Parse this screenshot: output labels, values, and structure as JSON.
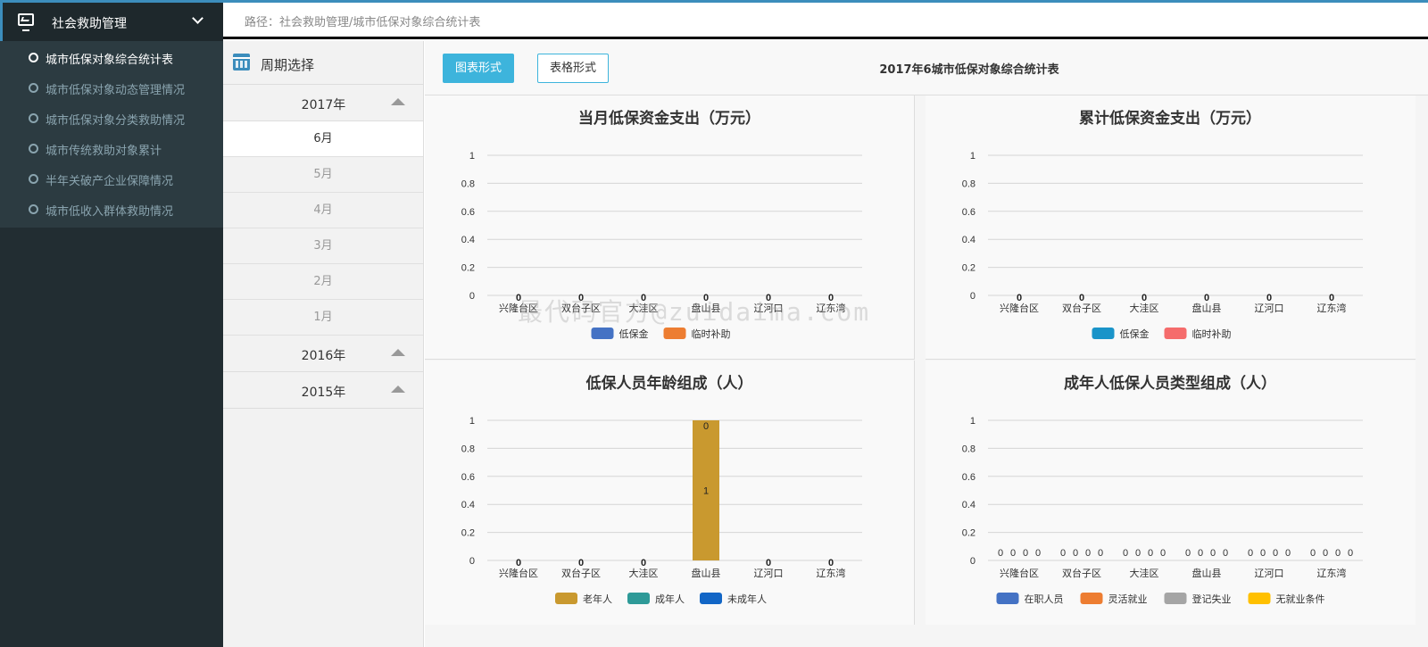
{
  "sidebar": {
    "header": "社会救助管理",
    "items": [
      {
        "label": "城市低保对象综合统计表",
        "active": true
      },
      {
        "label": "城市低保对象动态管理情况",
        "active": false
      },
      {
        "label": "城市低保对象分类救助情况",
        "active": false
      },
      {
        "label": "城市传统救助对象累计",
        "active": false
      },
      {
        "label": "半年关破产企业保障情况",
        "active": false
      },
      {
        "label": "城市低收入群体救助情况",
        "active": false
      }
    ]
  },
  "breadcrumb": "路径：社会救助管理/城市低保对象综合统计表",
  "period": {
    "title": "周期选择",
    "year_2017": "2017年",
    "months": [
      "6月",
      "5月",
      "4月",
      "3月",
      "2月",
      "1月"
    ],
    "selected_month": "6月",
    "year_2016": "2016年",
    "year_2015": "2015年"
  },
  "toolbar": {
    "chart_button": "图表形式",
    "table_button": "表格形式",
    "report_title": "2017年6城市低保对象综合统计表"
  },
  "watermark": "最代码官方@zuidaima.com",
  "chart_data": [
    {
      "type": "bar",
      "title": "当月低保资金支出（万元）",
      "categories": [
        "兴隆台区",
        "双台子区",
        "大洼区",
        "盘山县",
        "辽河口",
        "辽东湾"
      ],
      "ylim": [
        0,
        1
      ],
      "yticks": [
        0,
        0.2,
        0.4,
        0.6,
        0.8,
        1
      ],
      "series": [
        {
          "name": "低保金",
          "color": "#4472c4",
          "values": [
            0,
            0,
            0,
            0,
            0,
            0
          ]
        },
        {
          "name": "临时补助",
          "color": "#ed7d31",
          "values": [
            0,
            0,
            0,
            0,
            0,
            0
          ]
        }
      ],
      "value_labels": [
        [
          "0"
        ],
        [
          "0"
        ],
        [
          "0"
        ],
        [
          "0"
        ],
        [
          "0"
        ],
        [
          "0"
        ]
      ],
      "grid": true,
      "legend": "bottom"
    },
    {
      "type": "bar",
      "title": "累计低保资金支出（万元）",
      "categories": [
        "兴隆台区",
        "双台子区",
        "大洼区",
        "盘山县",
        "辽河口",
        "辽东湾"
      ],
      "ylim": [
        0,
        1
      ],
      "yticks": [
        0,
        0.2,
        0.4,
        0.6,
        0.8,
        1
      ],
      "series": [
        {
          "name": "低保金",
          "color": "#1a94c9",
          "values": [
            0,
            0,
            0,
            0,
            0,
            0
          ]
        },
        {
          "name": "临时补助",
          "color": "#f56c6c",
          "values": [
            0,
            0,
            0,
            0,
            0,
            0
          ]
        }
      ],
      "value_labels": [
        [
          "0"
        ],
        [
          "0"
        ],
        [
          "0"
        ],
        [
          "0"
        ],
        [
          "0"
        ],
        [
          "0"
        ]
      ],
      "grid": true,
      "legend": "bottom"
    },
    {
      "type": "bar",
      "title": "低保人员年龄组成（人）",
      "categories": [
        "兴隆台区",
        "双台子区",
        "大洼区",
        "盘山县",
        "辽河口",
        "辽东湾"
      ],
      "ylim": [
        0,
        1
      ],
      "yticks": [
        0,
        0.2,
        0.4,
        0.6,
        0.8,
        1
      ],
      "series": [
        {
          "name": "老年人",
          "color": "#c9992f",
          "values": [
            0,
            0,
            0,
            1,
            0,
            0
          ]
        },
        {
          "name": "成年人",
          "color": "#2e9a98",
          "values": [
            0,
            0,
            0,
            0,
            0,
            0
          ]
        },
        {
          "name": "未成年人",
          "color": "#1266c6",
          "values": [
            0,
            0,
            0,
            0,
            0,
            0
          ]
        }
      ],
      "value_labels": [
        [
          "0"
        ],
        [
          "0"
        ],
        [
          "0"
        ],
        [
          "0",
          "1"
        ],
        [
          "0"
        ],
        [
          "0"
        ]
      ],
      "grid": true,
      "legend": "bottom"
    },
    {
      "type": "bar",
      "title": "成年人低保人员类型组成（人）",
      "categories": [
        "兴隆台区",
        "双台子区",
        "大洼区",
        "盘山县",
        "辽河口",
        "辽东湾"
      ],
      "ylim": [
        0,
        1
      ],
      "yticks": [
        0,
        0.2,
        0.4,
        0.6,
        0.8,
        1
      ],
      "series": [
        {
          "name": "在职人员",
          "color": "#4472c4",
          "values": [
            0,
            0,
            0,
            0,
            0,
            0
          ]
        },
        {
          "name": "灵活就业",
          "color": "#ed7d31",
          "values": [
            0,
            0,
            0,
            0,
            0,
            0
          ]
        },
        {
          "name": "登记失业",
          "color": "#a5a5a5",
          "values": [
            0,
            0,
            0,
            0,
            0,
            0
          ]
        },
        {
          "name": "无就业条件",
          "color": "#ffc000",
          "values": [
            0,
            0,
            0,
            0,
            0,
            0
          ]
        }
      ],
      "value_labels": [
        [
          "0",
          "0",
          "0",
          "0"
        ],
        [
          "0",
          "0",
          "0",
          "0"
        ],
        [
          "0",
          "0",
          "0",
          "0"
        ],
        [
          "0",
          "0",
          "0",
          "0"
        ],
        [
          "0",
          "0",
          "0",
          "0"
        ],
        [
          "0",
          "0",
          "0",
          "0"
        ]
      ],
      "grid": true,
      "legend": "bottom"
    }
  ]
}
